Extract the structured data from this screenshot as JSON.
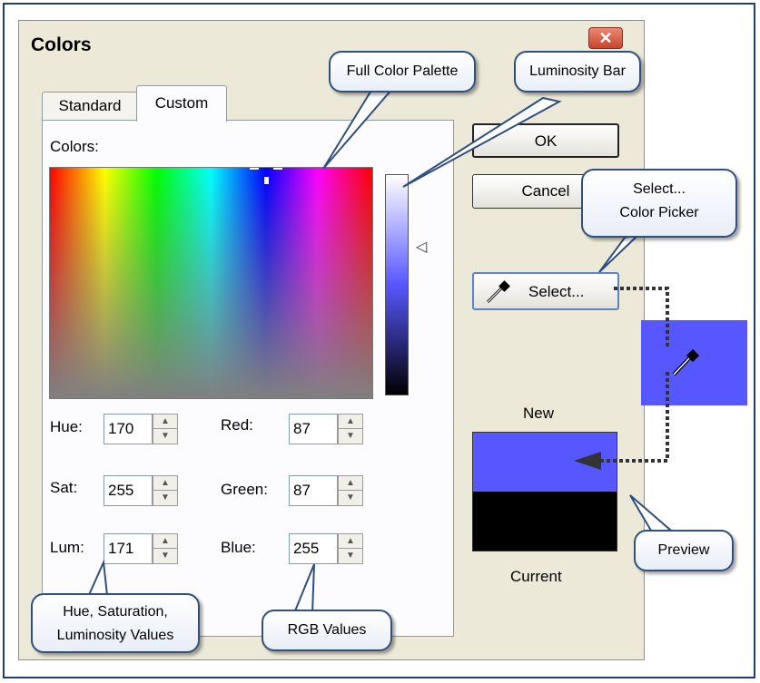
{
  "dialog": {
    "title": "Colors",
    "close_label": "✕",
    "tabs": [
      {
        "label": "Standard",
        "active": false
      },
      {
        "label": "Custom",
        "active": true
      }
    ],
    "colors_label": "Colors:",
    "fields": {
      "hue": {
        "label": "Hue:",
        "value": "170"
      },
      "sat": {
        "label": "Sat:",
        "value": "255"
      },
      "lum": {
        "label": "Lum:",
        "value": "171"
      },
      "red": {
        "label": "Red:",
        "value": "87"
      },
      "green": {
        "label": "Green:",
        "value": "87"
      },
      "blue": {
        "label": "Blue:",
        "value": "255"
      }
    },
    "buttons": {
      "ok": "OK",
      "cancel": "Cancel",
      "select": "Select..."
    },
    "preview": {
      "new_label": "New",
      "current_label": "Current",
      "new_color": "#5757ff",
      "current_color": "#000000"
    }
  },
  "callouts": {
    "full_color_palette": "Full Color Palette",
    "luminosity_bar": "Luminosity Bar",
    "select_color_picker_line1": "Select...",
    "select_color_picker_line2": "Color Picker",
    "preview": "Preview",
    "hsl_line1": "Hue, Saturation,",
    "hsl_line2": "Luminosity Values",
    "rgb": "RGB Values"
  },
  "icons": {
    "picker": "eyedropper-icon",
    "lum_pointer": "triangle-left-icon",
    "spin_up": "▲",
    "spin_down": "▼"
  },
  "colors": {
    "accent_frame": "#1f3f6b",
    "selected_color": "#5757ff"
  }
}
